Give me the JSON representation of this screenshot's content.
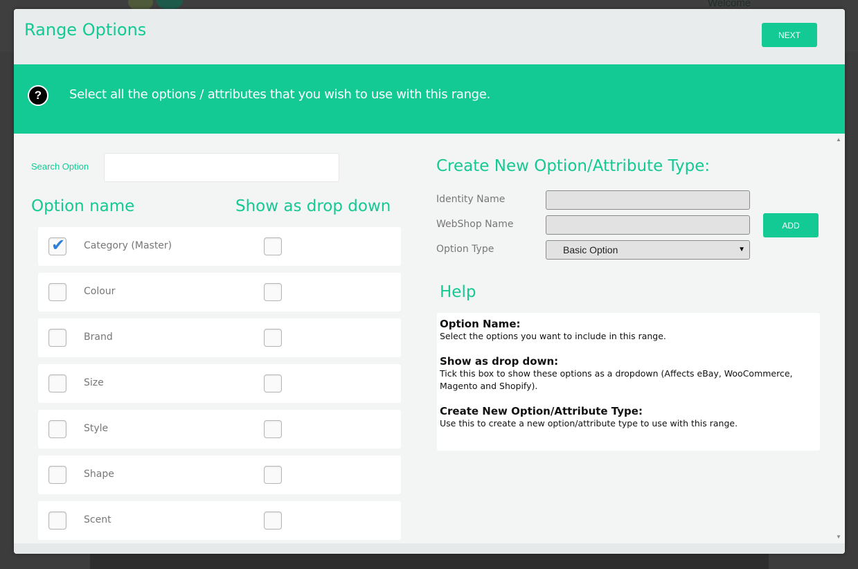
{
  "background": {
    "welcome": "Welcome"
  },
  "modal": {
    "title": "Range Options",
    "next_label": "NEXT",
    "banner_icon": "?",
    "banner_text": "Select all the options / attributes that you wish to use with this range."
  },
  "search": {
    "label": "Search Option",
    "value": ""
  },
  "columns": {
    "option_name": "Option name",
    "show_dropdown": "Show as drop down"
  },
  "options": [
    {
      "label": "Category (Master)",
      "selected": true,
      "dropdown": false
    },
    {
      "label": "Colour",
      "selected": false,
      "dropdown": false
    },
    {
      "label": "Brand",
      "selected": false,
      "dropdown": false
    },
    {
      "label": "Size",
      "selected": false,
      "dropdown": false
    },
    {
      "label": "Style",
      "selected": false,
      "dropdown": false
    },
    {
      "label": "Shape",
      "selected": false,
      "dropdown": false
    },
    {
      "label": "Scent",
      "selected": false,
      "dropdown": false
    }
  ],
  "create": {
    "title": "Create New Option/Attribute Type:",
    "identity_label": "Identity Name",
    "identity_value": "",
    "webshop_label": "WebShop Name",
    "webshop_value": "",
    "type_label": "Option Type",
    "type_value": "Basic Option",
    "add_label": "ADD"
  },
  "help": {
    "title": "Help",
    "sections": [
      {
        "heading": "Option Name:",
        "body": "Select the options you want to include in this range."
      },
      {
        "heading": "Show as drop down:",
        "body": "Tick this box to show these options as a dropdown (Affects eBay, WooCommerce, Magento and Shopify)."
      },
      {
        "heading": "Create New Option/Attribute Type:",
        "body": "Use this to create a new option/attribute type to use with this range."
      }
    ]
  },
  "colors": {
    "accent": "#13c994",
    "tick": "#2f7fd8"
  },
  "icons": {
    "help": "question-circle-icon",
    "check": "checkmark-icon",
    "caret": "caret-down-icon"
  }
}
